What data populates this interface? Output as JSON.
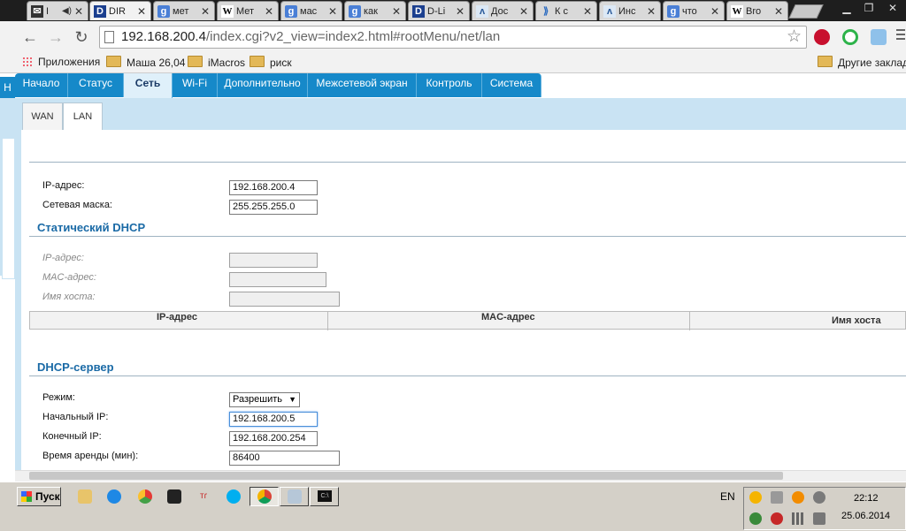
{
  "browser": {
    "tabs": [
      {
        "label": "I",
        "icon": "gmail-icon",
        "active": false
      },
      {
        "label": "DIR",
        "icon": "dlink-icon",
        "active": true
      },
      {
        "label": "мет",
        "icon": "google-icon",
        "active": false
      },
      {
        "label": "Мет",
        "icon": "wikipedia-icon",
        "active": false
      },
      {
        "label": "мас",
        "icon": "google-icon",
        "active": false
      },
      {
        "label": "как",
        "icon": "google-icon",
        "active": false
      },
      {
        "label": "D-Li",
        "icon": "dlink-icon",
        "active": false
      },
      {
        "label": "Доc",
        "icon": "bird-icon",
        "active": false
      },
      {
        "label": "К с",
        "icon": "rss-icon",
        "active": false
      },
      {
        "label": "Инс",
        "icon": "bird-icon",
        "active": false
      },
      {
        "label": "что",
        "icon": "google-icon",
        "active": false
      },
      {
        "label": "Bro",
        "icon": "wikipedia-icon",
        "active": false
      }
    ],
    "url_host": "192.168.200.4",
    "url_path": "/index.cgi?v2_view=index2.html#rootMenu/net/lan",
    "bookmarks": [
      {
        "label": "Приложения",
        "icon": "apps-grid-icon"
      },
      {
        "label": "Маша 26,04",
        "icon": "folder-icon"
      },
      {
        "label": "iMacros",
        "icon": "folder-icon"
      },
      {
        "label": "риск",
        "icon": "folder-icon"
      }
    ],
    "other_bookmarks": "Другие заклад"
  },
  "router": {
    "menu": [
      "Начало",
      "Статус",
      "Сеть",
      "Wi-Fi",
      "Дополнительно",
      "Межсетевой экран",
      "Контроль",
      "Система"
    ],
    "active_menu": "Сеть",
    "subtabs": [
      "WAN",
      "LAN"
    ],
    "active_subtab": "LAN",
    "lan": {
      "ip_label": "IP-адрес:",
      "ip_value": "192.168.200.4",
      "mask_label": "Сетевая маска:",
      "mask_value": "255.255.255.0"
    },
    "static_dhcp": {
      "title": "Статический DHCP",
      "ip_label": "IP-адрес:",
      "mac_label": "MAC-адрес:",
      "host_label": "Имя хоста:",
      "columns": [
        "IP-адрес",
        "MAC-адрес",
        "Имя хоста"
      ]
    },
    "dhcp_server": {
      "title": "DHCP-сервер",
      "mode_label": "Режим:",
      "mode_value": "Разрешить",
      "start_label": "Начальный IP:",
      "start_value": "192.168.200.5",
      "end_label": "Конечный IP:",
      "end_value": "192.168.200.254",
      "lease_label": "Время аренды (мин):",
      "lease_value": "86400"
    },
    "left_edge_letter": "Н"
  },
  "taskbar": {
    "start_label": "Пуск",
    "lang": "EN",
    "time": "22:12",
    "date": "25.06.2014"
  },
  "colors": {
    "menu_blue": "#1689c9",
    "section_title": "#1a6aa6",
    "subband": "#c9e3f3"
  }
}
